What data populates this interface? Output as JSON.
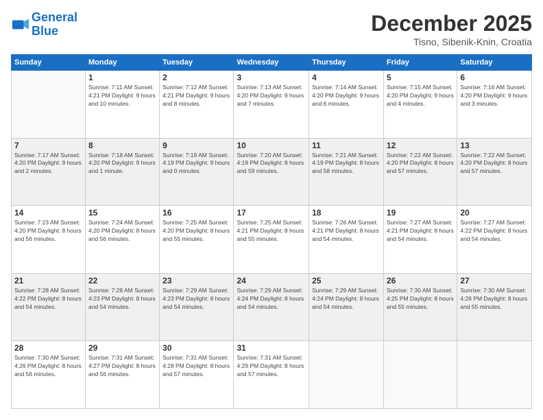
{
  "header": {
    "logo_line1": "General",
    "logo_line2": "Blue",
    "month_title": "December 2025",
    "location": "Tisno, Sibenik-Knin, Croatia"
  },
  "days_of_week": [
    "Sunday",
    "Monday",
    "Tuesday",
    "Wednesday",
    "Thursday",
    "Friday",
    "Saturday"
  ],
  "weeks": [
    [
      {
        "num": "",
        "info": ""
      },
      {
        "num": "1",
        "info": "Sunrise: 7:11 AM\nSunset: 4:21 PM\nDaylight: 9 hours\nand 10 minutes."
      },
      {
        "num": "2",
        "info": "Sunrise: 7:12 AM\nSunset: 4:21 PM\nDaylight: 9 hours\nand 8 minutes."
      },
      {
        "num": "3",
        "info": "Sunrise: 7:13 AM\nSunset: 4:20 PM\nDaylight: 9 hours\nand 7 minutes."
      },
      {
        "num": "4",
        "info": "Sunrise: 7:14 AM\nSunset: 4:20 PM\nDaylight: 9 hours\nand 6 minutes."
      },
      {
        "num": "5",
        "info": "Sunrise: 7:15 AM\nSunset: 4:20 PM\nDaylight: 9 hours\nand 4 minutes."
      },
      {
        "num": "6",
        "info": "Sunrise: 7:16 AM\nSunset: 4:20 PM\nDaylight: 9 hours\nand 3 minutes."
      }
    ],
    [
      {
        "num": "7",
        "info": "Sunrise: 7:17 AM\nSunset: 4:20 PM\nDaylight: 9 hours\nand 2 minutes."
      },
      {
        "num": "8",
        "info": "Sunrise: 7:18 AM\nSunset: 4:20 PM\nDaylight: 9 hours\nand 1 minute."
      },
      {
        "num": "9",
        "info": "Sunrise: 7:19 AM\nSunset: 4:19 PM\nDaylight: 9 hours\nand 0 minutes."
      },
      {
        "num": "10",
        "info": "Sunrise: 7:20 AM\nSunset: 4:19 PM\nDaylight: 8 hours\nand 59 minutes."
      },
      {
        "num": "11",
        "info": "Sunrise: 7:21 AM\nSunset: 4:19 PM\nDaylight: 8 hours\nand 58 minutes."
      },
      {
        "num": "12",
        "info": "Sunrise: 7:22 AM\nSunset: 4:20 PM\nDaylight: 8 hours\nand 57 minutes."
      },
      {
        "num": "13",
        "info": "Sunrise: 7:22 AM\nSunset: 4:20 PM\nDaylight: 8 hours\nand 57 minutes."
      }
    ],
    [
      {
        "num": "14",
        "info": "Sunrise: 7:23 AM\nSunset: 4:20 PM\nDaylight: 8 hours\nand 56 minutes."
      },
      {
        "num": "15",
        "info": "Sunrise: 7:24 AM\nSunset: 4:20 PM\nDaylight: 8 hours\nand 56 minutes."
      },
      {
        "num": "16",
        "info": "Sunrise: 7:25 AM\nSunset: 4:20 PM\nDaylight: 8 hours\nand 55 minutes."
      },
      {
        "num": "17",
        "info": "Sunrise: 7:25 AM\nSunset: 4:21 PM\nDaylight: 8 hours\nand 55 minutes."
      },
      {
        "num": "18",
        "info": "Sunrise: 7:26 AM\nSunset: 4:21 PM\nDaylight: 8 hours\nand 54 minutes."
      },
      {
        "num": "19",
        "info": "Sunrise: 7:27 AM\nSunset: 4:21 PM\nDaylight: 8 hours\nand 54 minutes."
      },
      {
        "num": "20",
        "info": "Sunrise: 7:27 AM\nSunset: 4:22 PM\nDaylight: 8 hours\nand 54 minutes."
      }
    ],
    [
      {
        "num": "21",
        "info": "Sunrise: 7:28 AM\nSunset: 4:22 PM\nDaylight: 8 hours\nand 54 minutes."
      },
      {
        "num": "22",
        "info": "Sunrise: 7:28 AM\nSunset: 4:23 PM\nDaylight: 8 hours\nand 54 minutes."
      },
      {
        "num": "23",
        "info": "Sunrise: 7:29 AM\nSunset: 4:23 PM\nDaylight: 8 hours\nand 54 minutes."
      },
      {
        "num": "24",
        "info": "Sunrise: 7:29 AM\nSunset: 4:24 PM\nDaylight: 8 hours\nand 54 minutes."
      },
      {
        "num": "25",
        "info": "Sunrise: 7:29 AM\nSunset: 4:24 PM\nDaylight: 8 hours\nand 54 minutes."
      },
      {
        "num": "26",
        "info": "Sunrise: 7:30 AM\nSunset: 4:25 PM\nDaylight: 8 hours\nand 55 minutes."
      },
      {
        "num": "27",
        "info": "Sunrise: 7:30 AM\nSunset: 4:26 PM\nDaylight: 8 hours\nand 55 minutes."
      }
    ],
    [
      {
        "num": "28",
        "info": "Sunrise: 7:30 AM\nSunset: 4:26 PM\nDaylight: 8 hours\nand 56 minutes."
      },
      {
        "num": "29",
        "info": "Sunrise: 7:31 AM\nSunset: 4:27 PM\nDaylight: 8 hours\nand 56 minutes."
      },
      {
        "num": "30",
        "info": "Sunrise: 7:31 AM\nSunset: 4:28 PM\nDaylight: 8 hours\nand 57 minutes."
      },
      {
        "num": "31",
        "info": "Sunrise: 7:31 AM\nSunset: 4:29 PM\nDaylight: 8 hours\nand 57 minutes."
      },
      {
        "num": "",
        "info": ""
      },
      {
        "num": "",
        "info": ""
      },
      {
        "num": "",
        "info": ""
      }
    ]
  ]
}
